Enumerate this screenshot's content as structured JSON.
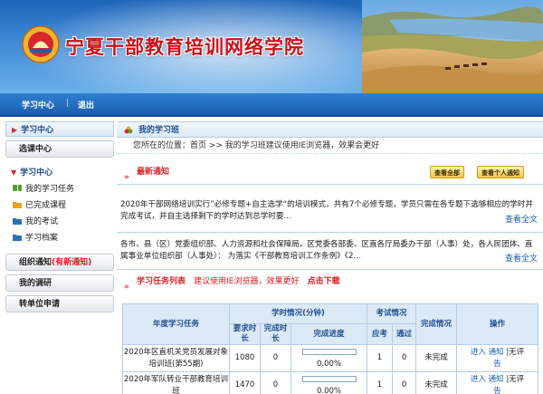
{
  "banner": {
    "title": "宁夏干部教育培训网络学院"
  },
  "topnav": {
    "home": "学习中心",
    "logout": "退出"
  },
  "sidebar": {
    "head1": "学习中心",
    "btn_center": "选课中心",
    "head2": "学习中心",
    "items": [
      {
        "label": "我的学习任务",
        "icon": "book-icon",
        "color": "#5b9d2f"
      },
      {
        "label": "已完成课程",
        "icon": "folder-icon",
        "color": "#e7a21a"
      },
      {
        "label": "我的考试",
        "icon": "folder-icon",
        "color": "#2f6fb6"
      },
      {
        "label": "学习档案",
        "icon": "folder-icon",
        "color": "#2f6fb6"
      }
    ],
    "btn_org": "组织通知",
    "btn_org_new": "(有新通知)",
    "btn_survey": "我的调研",
    "btn_transfer": "转单位申请"
  },
  "main": {
    "head": "我的学习班",
    "crumb": "您所在的位置：首页 >> 我的学习班建议使用IE浏览器，效果会更好",
    "notice_title": "最新通知",
    "btn_all_notice": "查看全部",
    "btn_personal_notice": "查看个人通知",
    "notices": [
      {
        "text": "2020年干部网络培训实行”必修专题+自主选学“的培训模式，共有7个必修专题，学员只需在各专题下选够相应的学时并完成考试，并自主选择剩下的学时达到总学时要...",
        "more": "查看全文"
      },
      {
        "text": "各市、县（区）党委组织部、人力资源和社会保障局，区党委各部委、区直各厅局委办干部（人事）处，各人民团体、直属事业单位组织部（人事处）：   为落实《干部教育培训工作条例》《2...",
        "more": "查看全文"
      }
    ],
    "task_title": "学习任务列表",
    "task_tip": "建议使用IE浏览器，效果更好",
    "task_download": "点击下载",
    "table": {
      "h_year": "年度学习任务",
      "h_hours": "学时情况(分钟)",
      "h_exam": "考试情况",
      "h_done": "完成情况",
      "h_op": "操作",
      "h_req": "要求时长",
      "h_fin": "完成时长",
      "h_prog": "完成进度",
      "h_should": "应考",
      "h_passed": "通过",
      "rows": [
        {
          "name": "2020年区直机关党员发展对象培训班(第55期)",
          "req": "1080",
          "fin": "0",
          "progress": 0,
          "progress_label": "0.00%",
          "should": "1",
          "passed": "0",
          "status": "未完成",
          "enter": "进入",
          "notice": "通知",
          "notice2": "告",
          "eval": "|无评"
        },
        {
          "name": "2020年军队转业干部教育培训班",
          "req": "1470",
          "fin": "0",
          "progress": 0,
          "progress_label": "0.00%",
          "should": "1",
          "passed": "0",
          "status": "未完成",
          "enter": "进入",
          "notice": "通知",
          "notice2": "告",
          "eval": "|无评"
        }
      ]
    }
  }
}
